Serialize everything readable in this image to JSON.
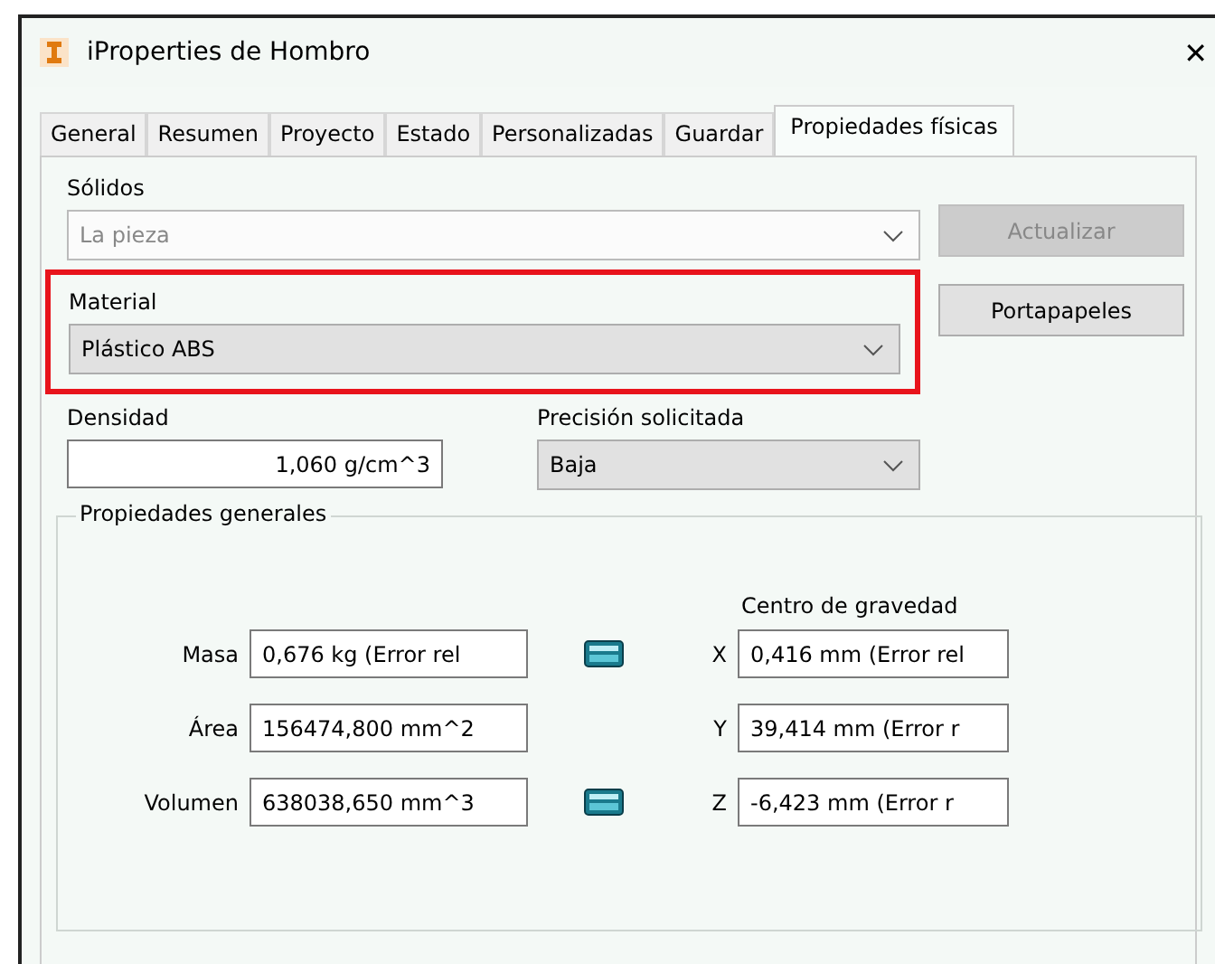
{
  "window": {
    "title": "iProperties de Hombro",
    "close": "✕"
  },
  "tabs": [
    {
      "label": "General",
      "selected": false
    },
    {
      "label": "Resumen",
      "selected": false
    },
    {
      "label": "Proyecto",
      "selected": false
    },
    {
      "label": "Estado",
      "selected": false
    },
    {
      "label": "Personalizadas",
      "selected": false
    },
    {
      "label": "Guardar",
      "selected": false
    },
    {
      "label": "Propiedades físicas",
      "selected": true
    }
  ],
  "solids": {
    "label": "Sólidos",
    "value": "La pieza",
    "disabled": true
  },
  "material": {
    "label": "Material",
    "value": "Plástico ABS",
    "highlighted": true
  },
  "buttons": [
    {
      "label": "Actualizar",
      "disabled": true
    },
    {
      "label": "Portapapeles",
      "disabled": false
    }
  ],
  "density": {
    "label": "Densidad",
    "value": "1,060 g/cm^3"
  },
  "precision": {
    "label": "Precisión solicitada",
    "value": "Baja"
  },
  "general": {
    "title": "Propiedades generales",
    "center_title": "Centro de gravedad",
    "rows": [
      {
        "label": "Masa",
        "value": "0,676 kg (Error rel",
        "calculator": true,
        "axis": "X",
        "center": "0,416 mm (Error rel"
      },
      {
        "label": "Área",
        "value": "156474,800 mm^2",
        "calculator": false,
        "axis": "Y",
        "center": "39,414 mm (Error r"
      },
      {
        "label": "Volumen",
        "value": "638038,650 mm^3",
        "calculator": true,
        "axis": "Z",
        "center": "-6,423 mm (Error r"
      }
    ]
  }
}
